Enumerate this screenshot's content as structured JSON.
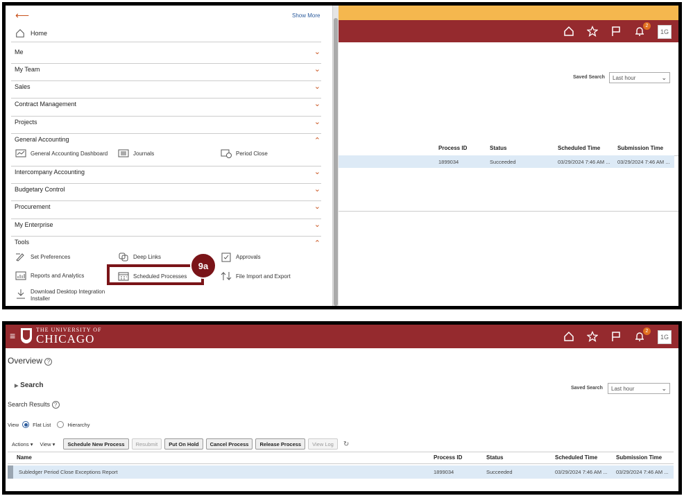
{
  "menu": {
    "show_more": "Show More",
    "home": "Home",
    "items": [
      "Me",
      "My Team",
      "Sales",
      "Contract Management",
      "Projects",
      "General Accounting",
      "Intercompany Accounting",
      "Budgetary Control",
      "Procurement",
      "My Enterprise",
      "Tools"
    ],
    "general_accounting_sub": [
      "General Accounting Dashboard",
      "Journals",
      "Period Close"
    ],
    "tools_sub": [
      "Set Preferences",
      "Deep Links",
      "Approvals",
      "Reports and Analytics",
      "Scheduled Processes",
      "File Import and Export",
      "Download Desktop Integration",
      "Installer"
    ],
    "callout": "9a"
  },
  "header": {
    "brand_line1": "THE UNIVERSITY OF",
    "brand_line2": "CHICAGO",
    "notification_count": "2",
    "avatar": "1G"
  },
  "page": {
    "title": "Overview",
    "search": "Search",
    "saved_search_label": "Saved Search",
    "saved_search_value": "Last hour",
    "search_results": "Search Results",
    "view_label": "View",
    "flat_list": "Flat List",
    "hierarchy": "Hierarchy",
    "actions": "Actions",
    "view_menu": "View",
    "buttons": [
      "Schedule New Process",
      "Resubmit",
      "Put On Hold",
      "Cancel Process",
      "Release Process",
      "View Log"
    ]
  },
  "table": {
    "headers": [
      "Name",
      "Process ID",
      "Status",
      "Scheduled Time",
      "Submission Time"
    ],
    "rows": [
      {
        "name": "Subledger Period Close Exceptions Report",
        "process_id": "1899034",
        "status": "Succeeded",
        "scheduled": "03/29/2024 7:46 AM ...",
        "submission": "03/29/2024 7:46 AM ..."
      }
    ]
  },
  "colors": {
    "header_red": "#952a2e",
    "gold": "#f5b74e",
    "accent_orange": "#c8511b",
    "callout": "#7a1418"
  }
}
